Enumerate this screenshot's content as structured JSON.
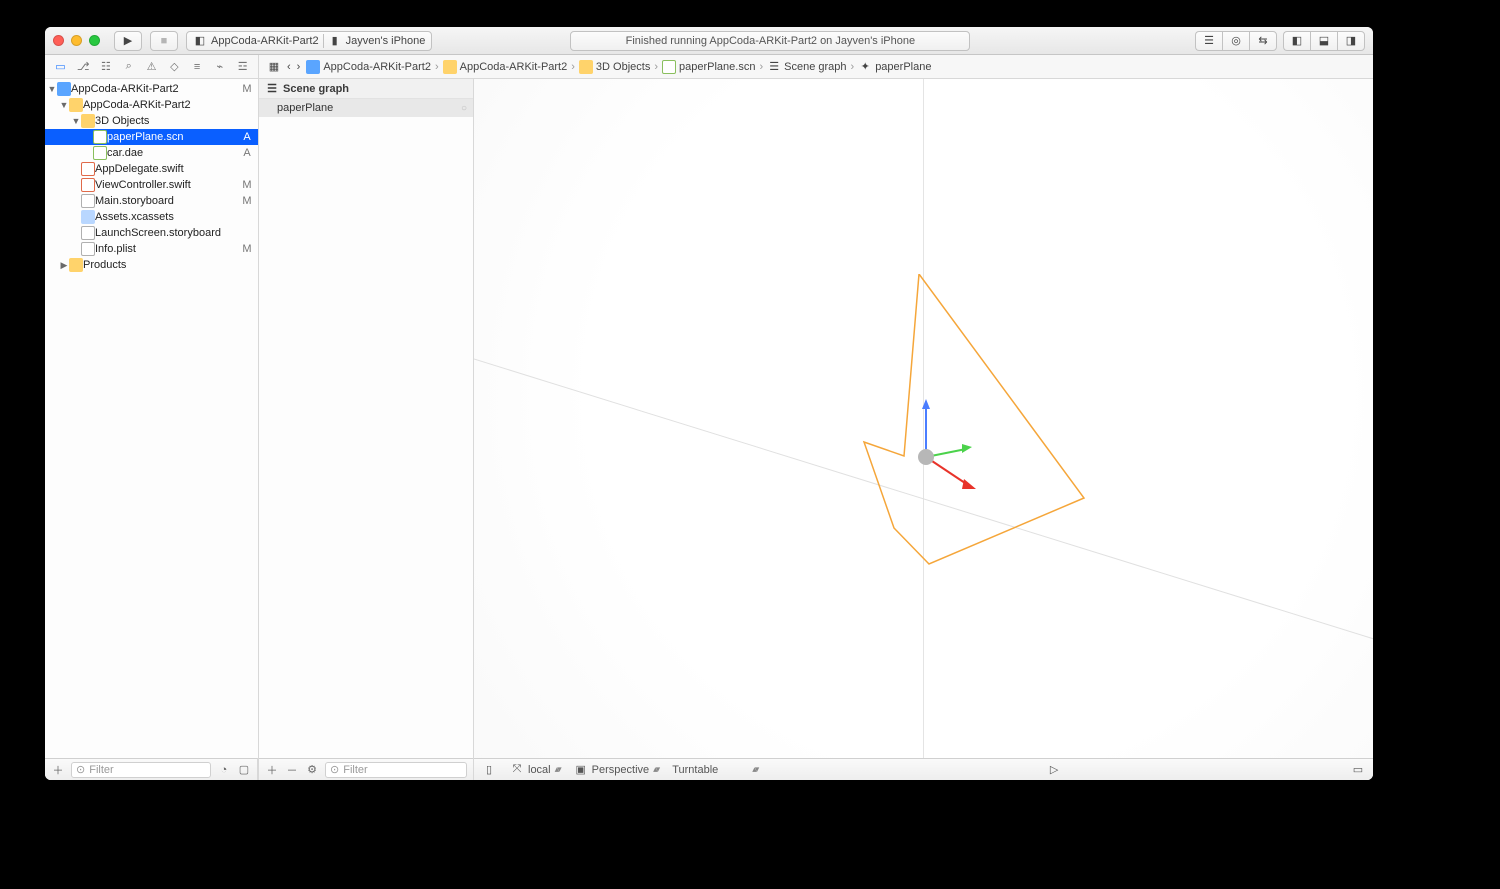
{
  "toolbar": {
    "scheme_name": "AppCoda-ARKit-Part2",
    "device_name": "Jayven's iPhone",
    "status_text": "Finished running AppCoda-ARKit-Part2 on Jayven's iPhone"
  },
  "breadcrumb": {
    "items": [
      "AppCoda-ARKit-Part2",
      "AppCoda-ARKit-Part2",
      "3D Objects",
      "paperPlane.scn",
      "Scene graph",
      "paperPlane"
    ]
  },
  "navigator": {
    "project": {
      "name": "AppCoda-ARKit-Part2",
      "status": "M"
    },
    "folder": {
      "name": "AppCoda-ARKit-Part2"
    },
    "objects_folder": {
      "name": "3D Objects"
    },
    "files": [
      {
        "name": "paperPlane.scn",
        "status": "A",
        "type": "scn",
        "selected": true
      },
      {
        "name": "car.dae",
        "status": "A",
        "type": "scn"
      },
      {
        "name": "AppDelegate.swift",
        "status": "",
        "type": "swift"
      },
      {
        "name": "ViewController.swift",
        "status": "M",
        "type": "swift"
      },
      {
        "name": "Main.storyboard",
        "status": "M",
        "type": "sb"
      },
      {
        "name": "Assets.xcassets",
        "status": "",
        "type": "assets"
      },
      {
        "name": "LaunchScreen.storyboard",
        "status": "",
        "type": "sb"
      },
      {
        "name": "Info.plist",
        "status": "M",
        "type": "plist"
      }
    ],
    "products": {
      "name": "Products"
    },
    "filter_placeholder": "Filter"
  },
  "scene_graph": {
    "title": "Scene graph",
    "items": [
      "paperPlane"
    ],
    "filter_placeholder": "Filter"
  },
  "viewport_controls": {
    "coord_space": "local",
    "projection": "Perspective",
    "interaction": "Turntable"
  }
}
